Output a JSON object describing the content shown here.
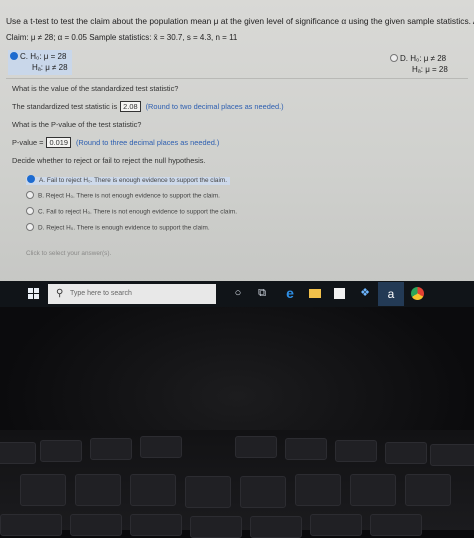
{
  "question": {
    "header": "Use a t-test to test the claim about the population mean μ at the given level of significance α using the given sample statistics. Assume the",
    "claim_line": "Claim: μ ≠ 28; α = 0.05   Sample statistics: x̄ = 30.7, s = 4.3, n = 11"
  },
  "choices": {
    "c": {
      "label": "C.",
      "h0": "H₀: μ = 28",
      "ha": "Hₐ: μ ≠ 28",
      "selected": true
    },
    "d": {
      "label": "D.",
      "h0": "H₀: μ ≠ 28",
      "ha": "Hₐ: μ = 28",
      "selected": false
    }
  },
  "standardized": {
    "question": "What is the value of the standardized test statistic?",
    "prefix": "The standardized test statistic is",
    "value": "2.08",
    "hint": "(Round to two decimal places as needed.)"
  },
  "pvalue": {
    "question": "What is the P-value of the test statistic?",
    "prefix": "P-value =",
    "value": "0.019",
    "hint": "(Round to three decimal places as needed.)"
  },
  "decision": {
    "question": "Decide whether to reject or fail to reject the null hypothesis.",
    "options": [
      {
        "label": "A.",
        "text": "Fail to reject H₀. There is enough evidence to support the claim.",
        "selected": true
      },
      {
        "label": "B.",
        "text": "Reject H₀. There is not enough evidence to support the claim.",
        "selected": false
      },
      {
        "label": "C.",
        "text": "Fail to reject H₀. There is not enough evidence to support the claim.",
        "selected": false
      },
      {
        "label": "D.",
        "text": "Reject H₀. There is enough evidence to support the claim.",
        "selected": false
      }
    ]
  },
  "footer": {
    "click_select": "Click to select your answer(s)."
  },
  "taskbar": {
    "search_placeholder": "Type here to search",
    "icons": [
      "windows-start-icon",
      "search-icon",
      "cortana-icon",
      "task-view-icon",
      "edge-icon",
      "file-explorer-icon",
      "store-icon",
      "dropbox-icon",
      "amazon-icon",
      "chrome-icon"
    ],
    "amazon_glyph": "a"
  },
  "colors": {
    "selected_radio": "#1d6bd0",
    "highlight": "#cdd9ea",
    "taskbar": "#101418"
  }
}
